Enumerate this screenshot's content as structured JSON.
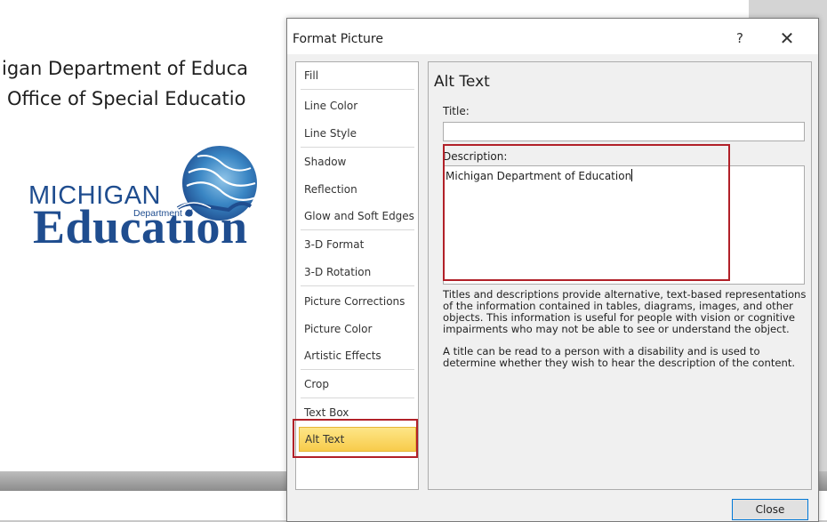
{
  "background": {
    "slide_lines": [
      "igan Department of Educa",
      "Office of Special Educatio"
    ],
    "logo": {
      "michigan_text": "MICHIGAN",
      "department_text": "Department of",
      "education_text": "Education"
    }
  },
  "dialog": {
    "title": "Format Picture",
    "help_label": "?",
    "close_label": "✕",
    "categories": [
      {
        "label": "Fill"
      },
      {
        "label": "Line Color"
      },
      {
        "label": "Line Style"
      },
      {
        "label": "Shadow"
      },
      {
        "label": "Reflection"
      },
      {
        "label": "Glow and Soft Edges"
      },
      {
        "label": "3-D Format"
      },
      {
        "label": "3-D Rotation"
      },
      {
        "label": "Picture Corrections"
      },
      {
        "label": "Picture Color"
      },
      {
        "label": "Artistic Effects"
      },
      {
        "label": "Crop"
      },
      {
        "label": "Text Box"
      },
      {
        "label": "Alt Text",
        "selected": true
      }
    ],
    "panel": {
      "heading": "Alt Text",
      "title_label": "Title:",
      "title_value": "",
      "description_label": "Description:",
      "description_value": "Michigan Department of Education",
      "help_paragraphs": [
        "Titles and descriptions provide alternative, text-based representations of the information contained in tables, diagrams, images, and other objects. This information is useful for people with vision or cognitive impairments who may not be able to see or understand the object.",
        "A title can be read to a person with a disability and is used to determine whether they wish to hear the description of the content."
      ]
    },
    "close_button": "Close"
  },
  "colors": {
    "highlight_red": "#b12028",
    "selected_yellow": "#f8cc4b",
    "logo_blue": "#1f4d8f"
  }
}
